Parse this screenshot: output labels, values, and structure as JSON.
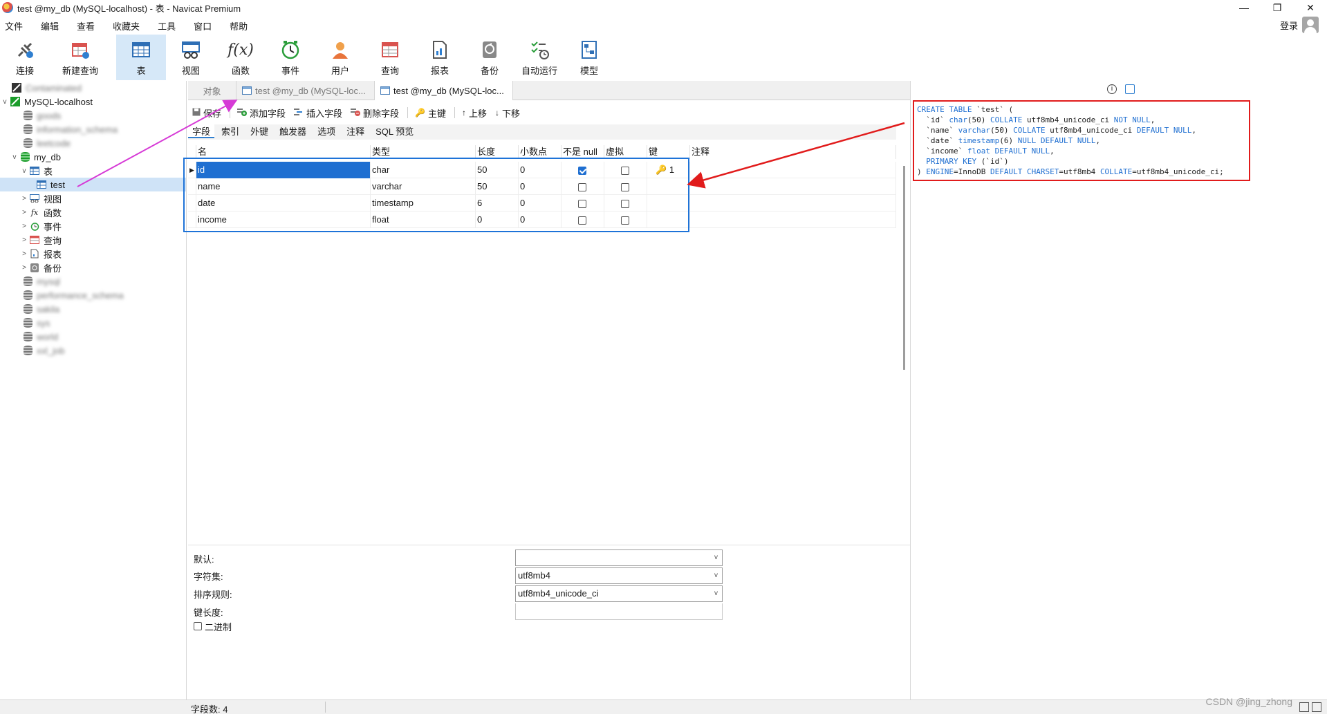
{
  "window": {
    "title": "test @my_db (MySQL-localhost) - 表 - Navicat Premium",
    "minimize": "—",
    "maximize": "❐",
    "close": "✕"
  },
  "menu": [
    "文件",
    "编辑",
    "查看",
    "收藏夹",
    "工具",
    "窗口",
    "帮助"
  ],
  "login_label": "登录",
  "toolbar": {
    "items": [
      {
        "label": "连接",
        "icon": "connect-icon"
      },
      {
        "label": "新建查询",
        "icon": "new-query-icon"
      },
      {
        "label": "表",
        "icon": "table-icon",
        "active": true
      },
      {
        "label": "视图",
        "icon": "view-icon"
      },
      {
        "label": "函数",
        "icon": "function-icon"
      },
      {
        "label": "事件",
        "icon": "event-icon"
      },
      {
        "label": "用户",
        "icon": "user-icon"
      },
      {
        "label": "查询",
        "icon": "query-icon"
      },
      {
        "label": "报表",
        "icon": "report-icon"
      },
      {
        "label": "备份",
        "icon": "backup-icon"
      },
      {
        "label": "自动运行",
        "icon": "automation-icon"
      },
      {
        "label": "模型",
        "icon": "model-icon"
      }
    ]
  },
  "tree": {
    "conn_blurred": "Contaminated",
    "conn": "MySQL-localhost",
    "dbs_before": [
      "goods",
      "information_schema",
      "leetcode"
    ],
    "db": "my_db",
    "tables_label": "表",
    "table": "test",
    "children": [
      "视图",
      "函数",
      "事件",
      "查询",
      "报表",
      "备份"
    ],
    "dbs_after": [
      "mysql",
      "performance_schema",
      "sakila",
      "sys",
      "world",
      "xxl_job"
    ]
  },
  "tabs": {
    "objects": "对象",
    "tab1": "test @my_db (MySQL-loc...",
    "tab2": "test @my_db (MySQL-loc..."
  },
  "editor_toolbar": {
    "save": "保存",
    "add_field": "添加字段",
    "insert_field": "插入字段",
    "delete_field": "删除字段",
    "primary_key": "主键",
    "move_up": "上移",
    "move_down": "下移"
  },
  "subtabs": [
    "字段",
    "索引",
    "外键",
    "触发器",
    "选项",
    "注释",
    "SQL 预览"
  ],
  "grid": {
    "headers": {
      "name": "名",
      "type": "类型",
      "length": "长度",
      "decimals": "小数点",
      "not_null": "不是 null",
      "virtual": "虚拟",
      "key": "键",
      "comment": "注释"
    },
    "rows": [
      {
        "name": "id",
        "type": "char",
        "length": "50",
        "decimals": "0",
        "not_null": true,
        "virtual": false,
        "key": "1"
      },
      {
        "name": "name",
        "type": "varchar",
        "length": "50",
        "decimals": "0",
        "not_null": false,
        "virtual": false,
        "key": ""
      },
      {
        "name": "date",
        "type": "timestamp",
        "length": "6",
        "decimals": "0",
        "not_null": false,
        "virtual": false,
        "key": ""
      },
      {
        "name": "income",
        "type": "float",
        "length": "0",
        "decimals": "0",
        "not_null": false,
        "virtual": false,
        "key": ""
      }
    ]
  },
  "props": {
    "default_label": "默认:",
    "default_value": "",
    "charset_label": "字符集:",
    "charset_value": "utf8mb4",
    "collation_label": "排序规则:",
    "collation_value": "utf8mb4_unicode_ci",
    "keylen_label": "键长度:",
    "binary_label": "二进制"
  },
  "sql_preview": [
    "CREATE TABLE `test` (",
    "  `id` char(50) COLLATE utf8mb4_unicode_ci NOT NULL,",
    "  `name` varchar(50) COLLATE utf8mb4_unicode_ci DEFAULT NULL,",
    "  `date` timestamp(6) NULL DEFAULT NULL,",
    "  `income` float DEFAULT NULL,",
    "  PRIMARY KEY (`id`)",
    ") ENGINE=InnoDB DEFAULT CHARSET=utf8mb4 COLLATE=utf8mb4_unicode_ci;"
  ],
  "status": {
    "field_count": "字段数: 4"
  },
  "watermark": "CSDN @jing_zhong",
  "colors": {
    "accent": "#1f6fd1",
    "annotation_red": "#e11b1b",
    "annotation_magenta": "#d63ad6",
    "annotation_blue": "#1e73d8"
  }
}
